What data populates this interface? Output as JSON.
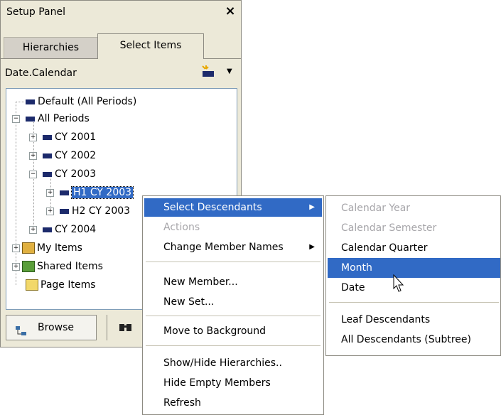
{
  "panel": {
    "title": "Setup Panel",
    "close": "×",
    "tabs": [
      {
        "label": "Hierarchies"
      },
      {
        "label": "Select Items"
      }
    ],
    "dimension": "Date.Calendar",
    "tree": [
      {
        "label": "Default (All Periods)"
      },
      {
        "label": "All Periods"
      },
      {
        "label": "CY 2001"
      },
      {
        "label": "CY 2002"
      },
      {
        "label": "CY 2003"
      },
      {
        "label": "H1 CY 2003"
      },
      {
        "label": "H2 CY 2003"
      },
      {
        "label": "CY 2004"
      },
      {
        "label": "My Items"
      },
      {
        "label": "Shared Items"
      },
      {
        "label": "Page Items"
      }
    ],
    "browse": "Browse"
  },
  "context_menu": {
    "items": [
      {
        "label": "Select Descendants"
      },
      {
        "label": "Actions"
      },
      {
        "label": "Change Member Names"
      },
      {
        "label": "New Member..."
      },
      {
        "label": "New Set..."
      },
      {
        "label": "Move to Background"
      },
      {
        "label": "Show/Hide Hierarchies.."
      },
      {
        "label": "Hide Empty Members"
      },
      {
        "label": "Refresh"
      }
    ]
  },
  "submenu": {
    "items": [
      {
        "label": "Calendar Year"
      },
      {
        "label": "Calendar Semester"
      },
      {
        "label": "Calendar Quarter"
      },
      {
        "label": "Month"
      },
      {
        "label": "Date"
      },
      {
        "label": "Leaf Descendants"
      },
      {
        "label": "All Descendants (Subtree)"
      }
    ]
  },
  "colors": {
    "highlight": "#316ac5",
    "panel_bg": "#ece9d8",
    "disabled": "#a7a6aa"
  }
}
